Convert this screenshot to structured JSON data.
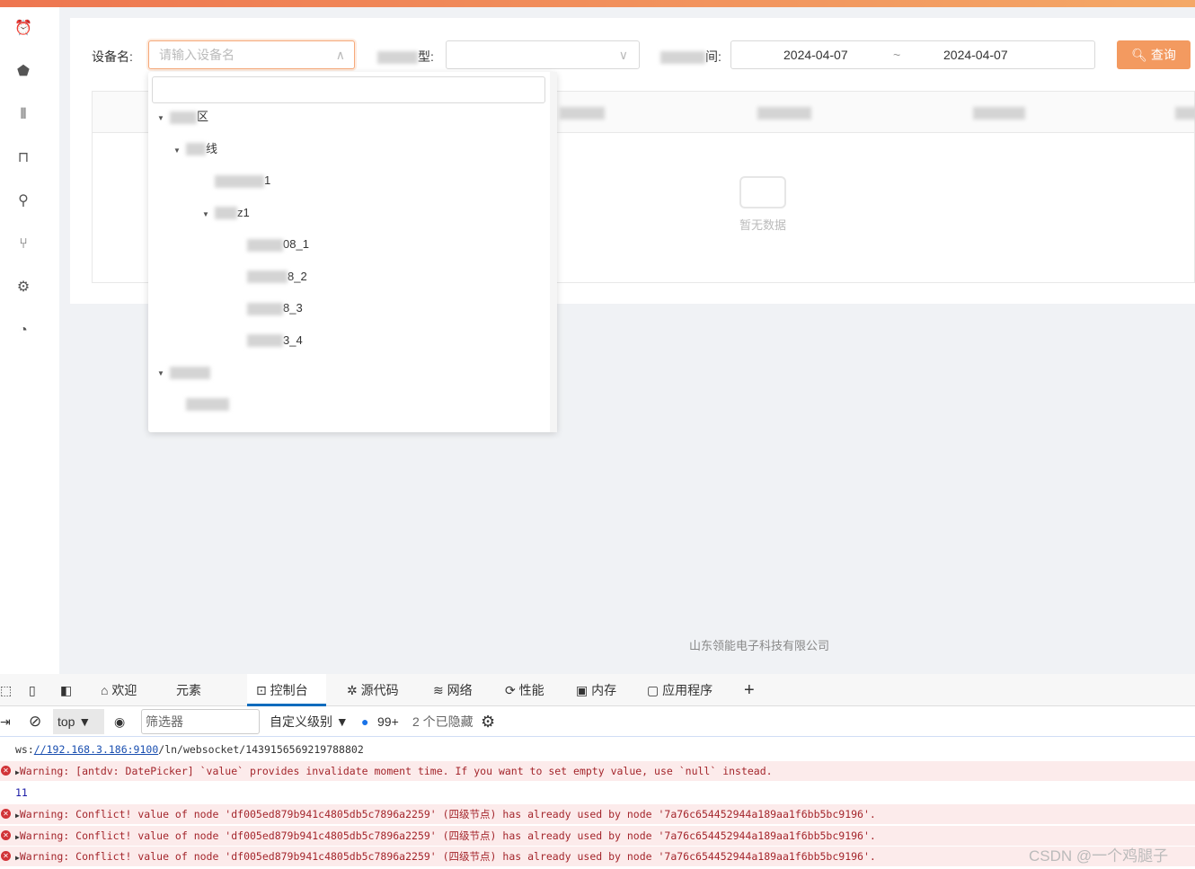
{
  "sidebar": {
    "icons": [
      "alarm-icon",
      "shield-icon",
      "sliders-icon",
      "device-icon",
      "plug-icon",
      "branch-icon",
      "gear-icon",
      "dashboard-icon"
    ]
  },
  "filters": {
    "device_label": "设备名:",
    "device_placeholder": "请输入设备名",
    "type_label_suffix": "型:",
    "time_label_suffix": "间:",
    "date_start": "2024-04-07",
    "date_sep": "~",
    "date_end": "2024-04-07",
    "query_label": "查询"
  },
  "tree": [
    {
      "suffix": "区",
      "level": 0,
      "expanded": true
    },
    {
      "suffix": "线",
      "level": 1,
      "expanded": true
    },
    {
      "suffix": "1",
      "level": 2
    },
    {
      "suffix": "z1",
      "level": 2,
      "expanded": true
    },
    {
      "suffix": "08_1",
      "level": 3
    },
    {
      "suffix": "8_2",
      "level": 3
    },
    {
      "suffix": "8_3",
      "level": 3
    },
    {
      "suffix": "3_4",
      "level": 3
    },
    {
      "suffix": "",
      "level": 0,
      "expanded": true
    },
    {
      "suffix": "",
      "level": 1
    }
  ],
  "table": {
    "empty_text": "暂无数据"
  },
  "footer": "山东领能电子科技有限公司",
  "devtools": {
    "tabs": [
      "欢迎",
      "元素",
      "控制台",
      "源代码",
      "网络",
      "性能",
      "内存",
      "应用程序"
    ],
    "active_tab": "控制台",
    "context": "top",
    "filter_placeholder": "筛选器",
    "level": "自定义级别",
    "msg_count": "99+",
    "hidden": "2 个已隐藏",
    "console": [
      {
        "type": "log",
        "prefix": "ws:",
        "link": "//192.168.3.186:9100",
        "rest": "/ln/websocket/1439156569219788802"
      },
      {
        "type": "error",
        "text": "Warning: [antdv: DatePicker] `value` provides invalidate moment time. If you want to set empty value, use `null` instead."
      },
      {
        "type": "number",
        "text": "11"
      },
      {
        "type": "error",
        "text": "Warning: Conflict! value of node 'df005ed879b941c4805db5c7896a2259' (四级节点) has already used by node '7a76c654452944a189aa1f6bb5bc9196'."
      },
      {
        "type": "error",
        "text": "Warning: Conflict! value of node 'df005ed879b941c4805db5c7896a2259' (四级节点) has already used by node '7a76c654452944a189aa1f6bb5bc9196'."
      },
      {
        "type": "error",
        "text": "Warning: Conflict! value of node 'df005ed879b941c4805db5c7896a2259' (四级节点) has already used by node '7a76c654452944a189aa1f6bb5bc9196'."
      }
    ]
  },
  "watermark": "CSDN @一个鸡腿子",
  "colors": {
    "accent": "#f39a60",
    "error_bg": "#fcebeb",
    "devtools_active": "#0f6cbd"
  }
}
